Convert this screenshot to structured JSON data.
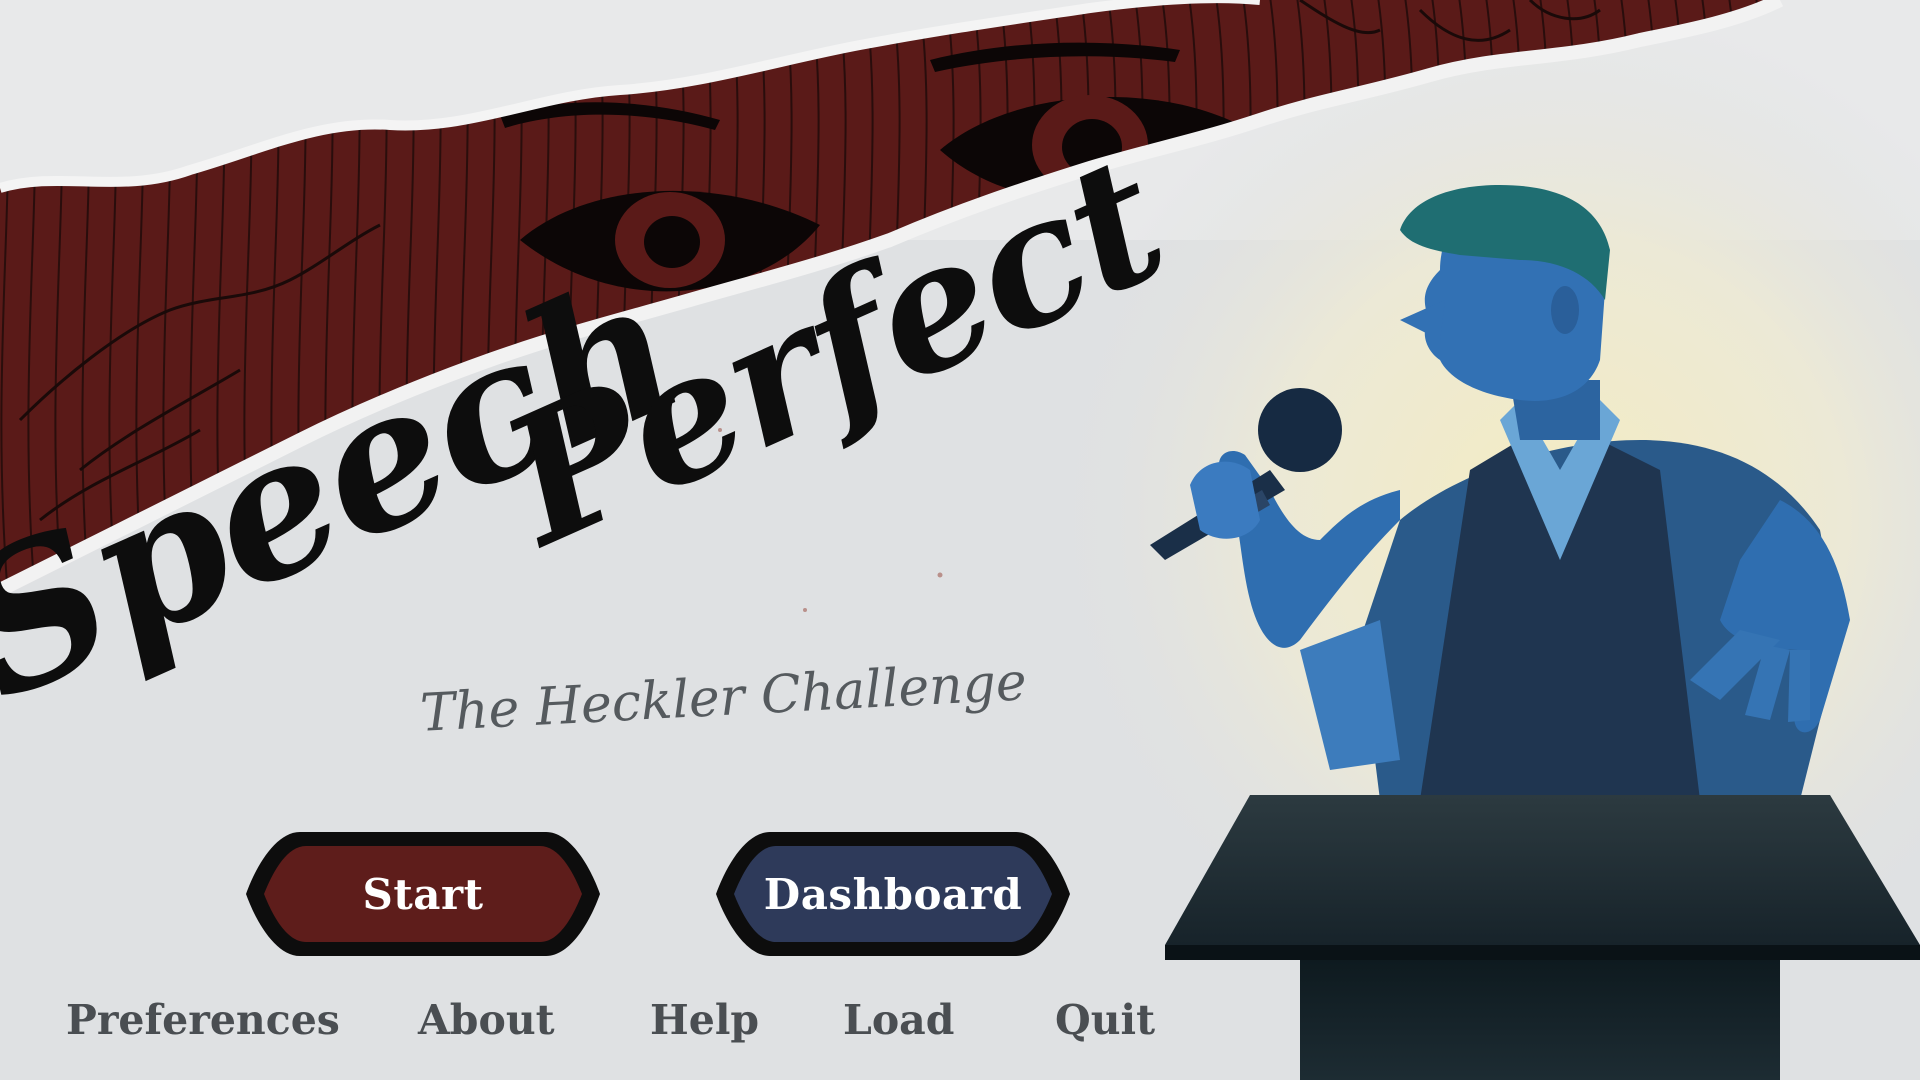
{
  "game": {
    "title_part1": "Speech",
    "title_part2": "Perfect",
    "subtitle": "The Heckler Challenge"
  },
  "buttons": {
    "start": {
      "label": "Start",
      "color": "#5e1d1b"
    },
    "dashboard": {
      "label": "Dashboard",
      "color": "#2e3a5a"
    }
  },
  "menu": {
    "preferences": "Preferences",
    "about": "About",
    "help": "Help",
    "load": "Load",
    "quit": "Quit"
  },
  "palette": {
    "banner_red": "#5a1a18",
    "paper": "#dfe1e3",
    "speaker_blue": "#2a6aa8",
    "podium_dark": "#18262b"
  },
  "art": {
    "banner": "torn-paper-eyes",
    "character": "speaker-with-microphone",
    "prop": "podium"
  }
}
